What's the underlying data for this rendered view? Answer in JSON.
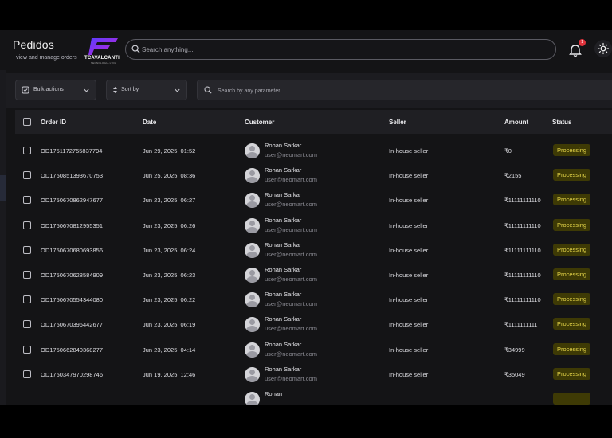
{
  "header": {
    "title": "Pedidos",
    "subtitle": "view and manage orders",
    "logo_text": "TCAVALCANTI",
    "logo_subtext": "TECNOLOGIA LTDA"
  },
  "search": {
    "placeholder": "Search anything..."
  },
  "notifications": {
    "count": "1"
  },
  "filters": {
    "bulk_actions_label": "Bulk actions",
    "sort_by_label": "Sort by",
    "parameter_search_placeholder": "Search by any parameter..."
  },
  "table": {
    "columns": {
      "order_id": "Order ID",
      "date": "Date",
      "customer": "Customer",
      "seller": "Seller",
      "amount": "Amount",
      "status": "Status"
    },
    "rows": [
      {
        "order_id": "OD1751172755837794",
        "date": "Jun 29, 2025, 01:52",
        "customer_name": "Rohan Sarkar",
        "customer_email": "user@neomart.com",
        "seller": "In-house seller",
        "amount": "₹0",
        "status": "Processing"
      },
      {
        "order_id": "OD1750851393670753",
        "date": "Jun 25, 2025, 08:36",
        "customer_name": "Rohan Sarkar",
        "customer_email": "user@neomart.com",
        "seller": "In-house seller",
        "amount": "₹2155",
        "status": "Processing"
      },
      {
        "order_id": "OD1750670862947677",
        "date": "Jun 23, 2025, 06:27",
        "customer_name": "Rohan Sarkar",
        "customer_email": "user@neomart.com",
        "seller": "In-house seller",
        "amount": "₹11111111110",
        "status": "Processing"
      },
      {
        "order_id": "OD1750670812955351",
        "date": "Jun 23, 2025, 06:26",
        "customer_name": "Rohan Sarkar",
        "customer_email": "user@neomart.com",
        "seller": "In-house seller",
        "amount": "₹11111111110",
        "status": "Processing"
      },
      {
        "order_id": "OD1750670680693856",
        "date": "Jun 23, 2025, 06:24",
        "customer_name": "Rohan Sarkar",
        "customer_email": "user@neomart.com",
        "seller": "In-house seller",
        "amount": "₹11111111110",
        "status": "Processing"
      },
      {
        "order_id": "OD1750670628584909",
        "date": "Jun 23, 2025, 06:23",
        "customer_name": "Rohan Sarkar",
        "customer_email": "user@neomart.com",
        "seller": "In-house seller",
        "amount": "₹11111111110",
        "status": "Processing"
      },
      {
        "order_id": "OD1750670554344080",
        "date": "Jun 23, 2025, 06:22",
        "customer_name": "Rohan Sarkar",
        "customer_email": "user@neomart.com",
        "seller": "In-house seller",
        "amount": "₹11111111110",
        "status": "Processing"
      },
      {
        "order_id": "OD1750670396442677",
        "date": "Jun 23, 2025, 06:19",
        "customer_name": "Rohan Sarkar",
        "customer_email": "user@neomart.com",
        "seller": "In-house seller",
        "amount": "₹1111111111",
        "status": "Processing"
      },
      {
        "order_id": "OD1750662840368277",
        "date": "Jun 23, 2025, 04:14",
        "customer_name": "Rohan Sarkar",
        "customer_email": "user@neomart.com",
        "seller": "In-house seller",
        "amount": "₹34999",
        "status": "Processing"
      },
      {
        "order_id": "OD1750347970298746",
        "date": "Jun 19, 2025, 12:46",
        "customer_name": "Rohan Sarkar",
        "customer_email": "user@neomart.com",
        "seller": "In-house seller",
        "amount": "₹35049",
        "status": "Processing"
      },
      {
        "order_id": "",
        "date": "",
        "customer_name": "Rohan",
        "customer_email": "",
        "seller": "",
        "amount": "",
        "status": ""
      }
    ]
  },
  "colors": {
    "background": "#141416",
    "status_processing_bg": "#3e3a05",
    "status_processing_text": "#e8d84a",
    "logo_accent": "#8a2be2",
    "badge": "#e0333c"
  }
}
